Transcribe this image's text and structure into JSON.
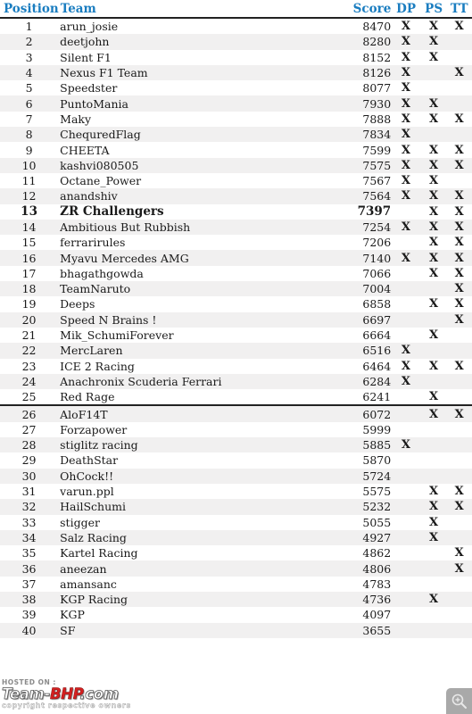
{
  "table": {
    "headers": {
      "position": "Position",
      "team": "Team",
      "score": "Score",
      "dp": "DP",
      "ps": "PS",
      "tt": "TT"
    },
    "header_color": "#1a7dc0",
    "mark": "X",
    "rows": [
      {
        "position": "1",
        "team": "arun_josie",
        "score": "8470",
        "dp": "X",
        "ps": "X",
        "tt": "X"
      },
      {
        "position": "2",
        "team": "deetjohn",
        "score": "8280",
        "dp": "X",
        "ps": "X",
        "tt": ""
      },
      {
        "position": "3",
        "team": "Silent F1",
        "score": "8152",
        "dp": "X",
        "ps": "X",
        "tt": ""
      },
      {
        "position": "4",
        "team": "Nexus F1 Team",
        "score": "8126",
        "dp": "X",
        "ps": "",
        "tt": "X"
      },
      {
        "position": "5",
        "team": "Speedster",
        "score": "8077",
        "dp": "X",
        "ps": "",
        "tt": ""
      },
      {
        "position": "6",
        "team": "PuntoMania",
        "score": "7930",
        "dp": "X",
        "ps": "X",
        "tt": ""
      },
      {
        "position": "7",
        "team": "Maky",
        "score": "7888",
        "dp": "X",
        "ps": "X",
        "tt": "X"
      },
      {
        "position": "8",
        "team": "ChequredFlag",
        "score": "7834",
        "dp": "X",
        "ps": "",
        "tt": ""
      },
      {
        "position": "9",
        "team": "CHEETA",
        "score": "7599",
        "dp": "X",
        "ps": "X",
        "tt": "X"
      },
      {
        "position": "10",
        "team": "kashvi080505",
        "score": "7575",
        "dp": "X",
        "ps": "X",
        "tt": "X"
      },
      {
        "position": "11",
        "team": "Octane_Power",
        "score": "7567",
        "dp": "X",
        "ps": "X",
        "tt": ""
      },
      {
        "position": "12",
        "team": "anandshiv",
        "score": "7564",
        "dp": "X",
        "ps": "X",
        "tt": "X"
      },
      {
        "position": "13",
        "team": "ZR Challengers",
        "score": "7397",
        "dp": "",
        "ps": "X",
        "tt": "X",
        "highlight": true
      },
      {
        "position": "14",
        "team": "Ambitious But Rubbish",
        "score": "7254",
        "dp": "X",
        "ps": "X",
        "tt": "X"
      },
      {
        "position": "15",
        "team": "ferrarirules",
        "score": "7206",
        "dp": "",
        "ps": "X",
        "tt": "X"
      },
      {
        "position": "16",
        "team": "Myavu Mercedes AMG",
        "score": "7140",
        "dp": "X",
        "ps": "X",
        "tt": "X"
      },
      {
        "position": "17",
        "team": "bhagathgowda",
        "score": "7066",
        "dp": "",
        "ps": "X",
        "tt": "X"
      },
      {
        "position": "18",
        "team": "TeamNaruto",
        "score": "7004",
        "dp": "",
        "ps": "",
        "tt": "X"
      },
      {
        "position": "19",
        "team": "Deeps",
        "score": "6858",
        "dp": "",
        "ps": "X",
        "tt": "X"
      },
      {
        "position": "20",
        "team": "Speed N Brains !",
        "score": "6697",
        "dp": "",
        "ps": "",
        "tt": "X"
      },
      {
        "position": "21",
        "team": "Mik_SchumiForever",
        "score": "6664",
        "dp": "",
        "ps": "X",
        "tt": ""
      },
      {
        "position": "22",
        "team": "MercLaren",
        "score": "6516",
        "dp": "X",
        "ps": "",
        "tt": ""
      },
      {
        "position": "23",
        "team": "ICE 2 Racing",
        "score": "6464",
        "dp": "X",
        "ps": "X",
        "tt": "X"
      },
      {
        "position": "24",
        "team": "Anachronix Scuderia Ferrari",
        "score": "6284",
        "dp": "X",
        "ps": "",
        "tt": ""
      },
      {
        "position": "25",
        "team": "Red Rage",
        "score": "6241",
        "dp": "",
        "ps": "X",
        "tt": ""
      },
      {
        "position": "26",
        "team": "AloF14T",
        "score": "6072",
        "dp": "",
        "ps": "X",
        "tt": "X",
        "divider_above": true
      },
      {
        "position": "27",
        "team": "Forzapower",
        "score": "5999",
        "dp": "",
        "ps": "",
        "tt": ""
      },
      {
        "position": "28",
        "team": "stiglitz racing",
        "score": "5885",
        "dp": "X",
        "ps": "",
        "tt": ""
      },
      {
        "position": "29",
        "team": "DeathStar",
        "score": "5870",
        "dp": "",
        "ps": "",
        "tt": ""
      },
      {
        "position": "30",
        "team": "OhCock!!",
        "score": "5724",
        "dp": "",
        "ps": "",
        "tt": ""
      },
      {
        "position": "31",
        "team": "varun.ppl",
        "score": "5575",
        "dp": "",
        "ps": "X",
        "tt": "X"
      },
      {
        "position": "32",
        "team": "HailSchumi",
        "score": "5232",
        "dp": "",
        "ps": "X",
        "tt": "X"
      },
      {
        "position": "33",
        "team": "stigger",
        "score": "5055",
        "dp": "",
        "ps": "X",
        "tt": ""
      },
      {
        "position": "34",
        "team": "Salz Racing",
        "score": "4927",
        "dp": "",
        "ps": "X",
        "tt": ""
      },
      {
        "position": "35",
        "team": "Kartel Racing",
        "score": "4862",
        "dp": "",
        "ps": "",
        "tt": "X"
      },
      {
        "position": "36",
        "team": "aneezan",
        "score": "4806",
        "dp": "",
        "ps": "",
        "tt": "X"
      },
      {
        "position": "37",
        "team": "amansanc",
        "score": "4783",
        "dp": "",
        "ps": "",
        "tt": ""
      },
      {
        "position": "38",
        "team": "KGP Racing",
        "score": "4736",
        "dp": "",
        "ps": "X",
        "tt": ""
      },
      {
        "position": "39",
        "team": "KGP",
        "score": "4097",
        "dp": "",
        "ps": "",
        "tt": ""
      },
      {
        "position": "40",
        "team": "SF",
        "score": "3655",
        "dp": "",
        "ps": "",
        "tt": ""
      }
    ]
  },
  "watermark": {
    "hosted_on": "HOSTED ON :",
    "logo_team": "Team-",
    "logo_bhp": "BHP",
    "logo_dotcom": ".com",
    "copyright": "copyright respective owners"
  },
  "zoom_control": {
    "icon": "zoom-in-icon"
  }
}
